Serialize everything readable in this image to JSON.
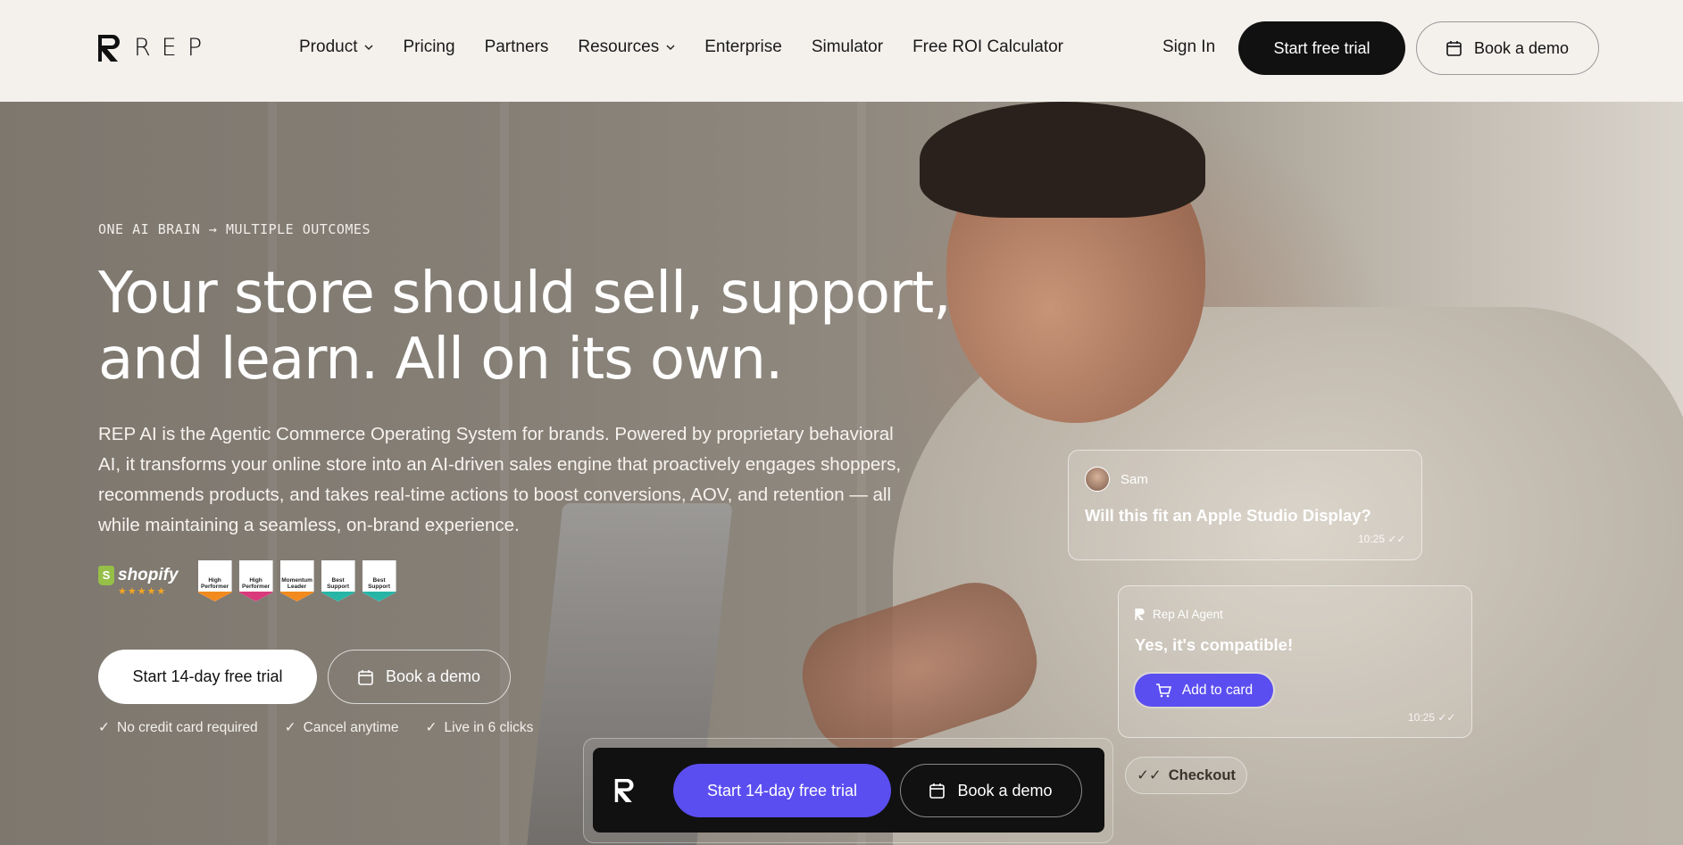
{
  "header": {
    "logo_text": "REP",
    "nav": [
      {
        "label": "Product",
        "has_dropdown": true
      },
      {
        "label": "Pricing",
        "has_dropdown": false
      },
      {
        "label": "Partners",
        "has_dropdown": false
      },
      {
        "label": "Resources",
        "has_dropdown": true
      },
      {
        "label": "Enterprise",
        "has_dropdown": false
      },
      {
        "label": "Simulator",
        "has_dropdown": false
      },
      {
        "label": "Free ROI Calculator",
        "has_dropdown": false
      }
    ],
    "sign_in": "Sign In",
    "start_trial": "Start free trial",
    "book_demo": "Book a demo"
  },
  "hero": {
    "eyebrow": "ONE AI BRAIN → MULTIPLE OUTCOMES",
    "headline_line1": "Your store should sell, support,",
    "headline_line2": "and learn. All on its own.",
    "subtext": "REP AI is the Agentic Commerce Operating System for brands. Powered by proprietary behavioral AI, it transforms your online store into an AI-driven sales engine that proactively engages shoppers, recommends products, and takes real-time actions to boost conversions, AOV, and retention — all while maintaining a seamless, on-brand experience.",
    "shopify_label": "shopify",
    "shopify_stars": "★★★★★",
    "g2_badges": [
      {
        "label": "High Performer",
        "color": "orange"
      },
      {
        "label": "High Performer",
        "color": "pink"
      },
      {
        "label": "Momentum Leader",
        "color": "orange"
      },
      {
        "label": "Best Support",
        "color": "teal"
      },
      {
        "label": "Best Support",
        "color": "teal"
      }
    ],
    "cta_trial": "Start 14-day free trial",
    "cta_demo": "Book a demo",
    "checks": [
      "No credit card required",
      "Cancel anytime",
      "Live in 6 clicks"
    ]
  },
  "chat": {
    "user_name": "Sam",
    "user_message": "Will this fit an Apple Studio Display?",
    "user_time": "10:25",
    "agent_label": "Rep AI Agent",
    "agent_message": "Yes, it's compatible!",
    "add_button": "Add to card",
    "agent_time": "10:25",
    "checkout": "Checkout"
  },
  "floating_bar": {
    "cta_trial": "Start 14-day free trial",
    "cta_demo": "Book a demo"
  },
  "colors": {
    "accent": "#5b4ef0",
    "dark": "#111111",
    "header_bg": "#f4f1ed"
  }
}
